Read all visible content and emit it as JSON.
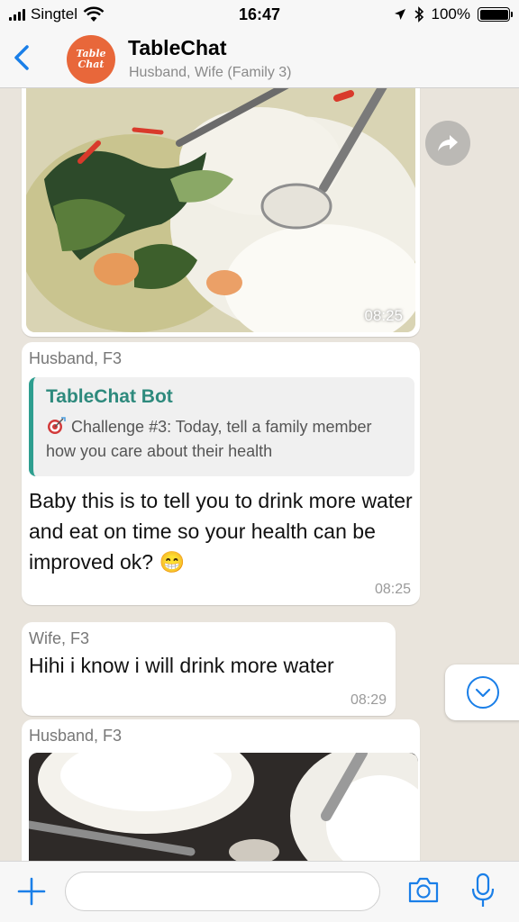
{
  "status_bar": {
    "carrier": "Singtel",
    "time": "16:47",
    "battery_percent": "100%",
    "battery_level": 1.0
  },
  "header": {
    "avatar_line1": "Table",
    "avatar_line2": "Chat",
    "title": "TableChat",
    "subtitle": "Husband, Wife (Family 3)"
  },
  "messages": [
    {
      "type": "photo",
      "time": "08:25"
    },
    {
      "type": "text",
      "sender": "Husband, F3",
      "quote": {
        "title": "TableChat Bot",
        "text": "Challenge #3: Today, tell a family member how you care about their health"
      },
      "text": "Baby this is to tell you to drink more water and eat on time so your health can be improved ok? 😁",
      "time": "08:25"
    },
    {
      "type": "text",
      "sender": "Wife, F3",
      "text": "Hihi i know i will drink more water",
      "time": "08:29"
    },
    {
      "type": "photo",
      "sender": "Husband, F3"
    }
  ],
  "colors": {
    "accent": "#1a7fe8",
    "avatar_bg": "#e8673a",
    "quote_bar": "#2e9e8f",
    "chat_bg": "#e9e4dc"
  },
  "icons": {
    "back": "chevron-left-icon",
    "forward": "share-arrow-icon",
    "scroll": "chevron-down-circle-icon",
    "plus": "plus-icon",
    "camera": "camera-icon",
    "mic": "microphone-icon",
    "target": "target-icon"
  }
}
